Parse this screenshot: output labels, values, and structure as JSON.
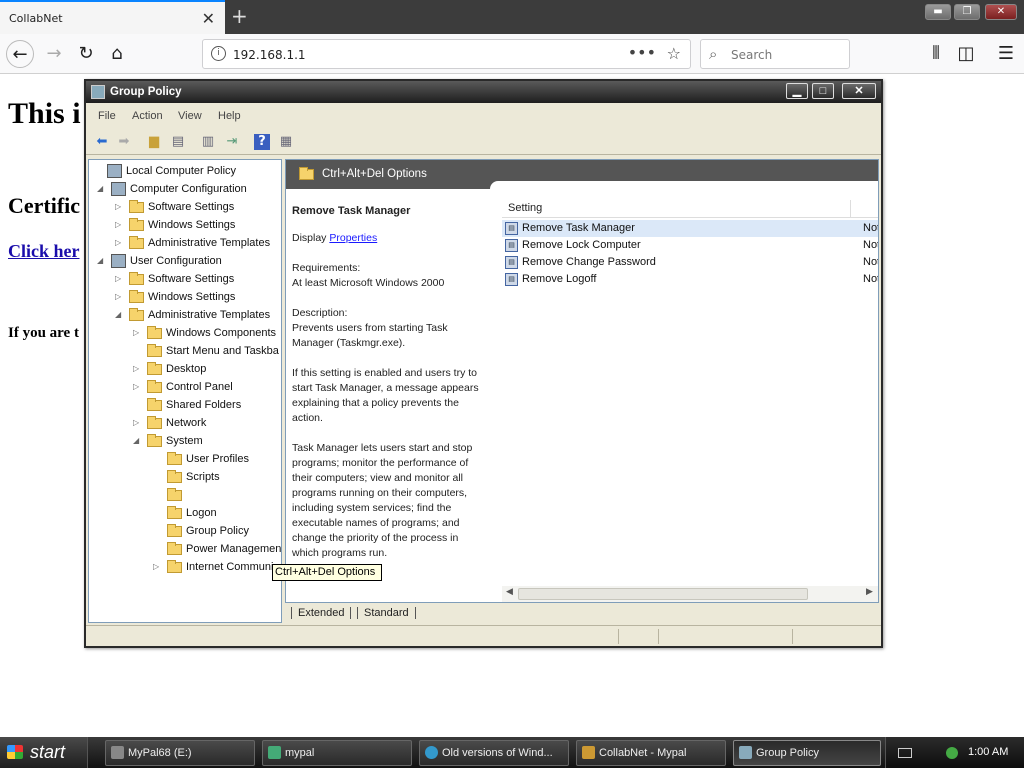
{
  "browser": {
    "tab_title": "CollabNet",
    "tab_close": "✕",
    "new_tab": "+",
    "url": "192.168.1.1",
    "search_placeholder": "Search",
    "window_controls": [
      "▬",
      "❐",
      "✕"
    ]
  },
  "page": {
    "heading": "This i",
    "subheading": "Certific",
    "link": "Click her",
    "paragraph": "If you are t"
  },
  "gp": {
    "title": "Group Policy",
    "title_buttons": [
      "▁",
      "□",
      "✕"
    ],
    "menu": [
      "File",
      "Action",
      "View",
      "Help"
    ],
    "tree": [
      {
        "label": "Local Computer Policy",
        "icon": "gp",
        "exp": "",
        "indent": 0
      },
      {
        "label": "Computer Configuration",
        "icon": "gp",
        "exp": "◢",
        "indent": 1
      },
      {
        "label": "Software Settings",
        "icon": "folder",
        "exp": "▷",
        "indent": 2
      },
      {
        "label": "Windows Settings",
        "icon": "folder",
        "exp": "▷",
        "indent": 2
      },
      {
        "label": "Administrative Templates",
        "icon": "folder",
        "exp": "▷",
        "indent": 2
      },
      {
        "label": "User Configuration",
        "icon": "gp",
        "exp": "◢",
        "indent": 1
      },
      {
        "label": "Software Settings",
        "icon": "folder",
        "exp": "▷",
        "indent": 2
      },
      {
        "label": "Windows Settings",
        "icon": "folder",
        "exp": "▷",
        "indent": 2
      },
      {
        "label": "Administrative Templates",
        "icon": "folder",
        "exp": "◢",
        "indent": 2
      },
      {
        "label": "Windows Components",
        "icon": "folder",
        "exp": "▷",
        "indent": 3
      },
      {
        "label": "Start Menu and Taskba",
        "icon": "folder",
        "exp": "",
        "indent": 3
      },
      {
        "label": "Desktop",
        "icon": "folder",
        "exp": "▷",
        "indent": 3
      },
      {
        "label": "Control Panel",
        "icon": "folder",
        "exp": "▷",
        "indent": 3
      },
      {
        "label": "Shared Folders",
        "icon": "folder",
        "exp": "",
        "indent": 3
      },
      {
        "label": "Network",
        "icon": "folder",
        "exp": "▷",
        "indent": 3
      },
      {
        "label": "System",
        "icon": "folder",
        "exp": "◢",
        "indent": 3
      },
      {
        "label": "User Profiles",
        "icon": "folder",
        "exp": "",
        "indent": 4
      },
      {
        "label": "Scripts",
        "icon": "folder",
        "exp": "",
        "indent": 4
      },
      {
        "label": "",
        "icon": "folder",
        "exp": "",
        "indent": 4
      },
      {
        "label": "Logon",
        "icon": "folder",
        "exp": "",
        "indent": 4
      },
      {
        "label": "Group Policy",
        "icon": "folder",
        "exp": "",
        "indent": 4
      },
      {
        "label": "Power Managemen",
        "icon": "folder",
        "exp": "",
        "indent": 4
      },
      {
        "label": "Internet Communi",
        "icon": "folder",
        "exp": "▷",
        "indent": 4
      }
    ],
    "tooltip": "Ctrl+Alt+Del Options",
    "header": "Ctrl+Alt+Del Options",
    "description": {
      "title": "Remove Task Manager",
      "display_label": "Display",
      "properties_link": "Properties",
      "req_label": "Requirements:",
      "req_value": "At least Microsoft Windows 2000",
      "desc_label": "Description:",
      "desc1": "Prevents users from starting Task Manager (Taskmgr.exe).",
      "desc2": "If this setting is enabled and users try to start Task Manager, a message appears explaining that a policy prevents the action.",
      "desc3": "Task Manager lets users start and stop programs; monitor the performance of their computers; view and monitor all programs running on their computers, including system services; find the executable names of programs; and change the priority of the process in which programs run."
    },
    "list_header": "Setting",
    "rows": [
      {
        "label": "Remove Task Manager",
        "state": "Not"
      },
      {
        "label": "Remove Lock Computer",
        "state": "Not"
      },
      {
        "label": "Remove Change Password",
        "state": "Not"
      },
      {
        "label": "Remove Logoff",
        "state": "Not"
      }
    ],
    "tabs": [
      "Extended",
      "Standard"
    ]
  },
  "taskbar": {
    "start": "start",
    "tasks": [
      "MyPal68 (E:)",
      "mypal",
      "Old versions of Wind...",
      "CollabNet - Mypal",
      "Group Policy"
    ],
    "clock": "1:00 AM"
  }
}
